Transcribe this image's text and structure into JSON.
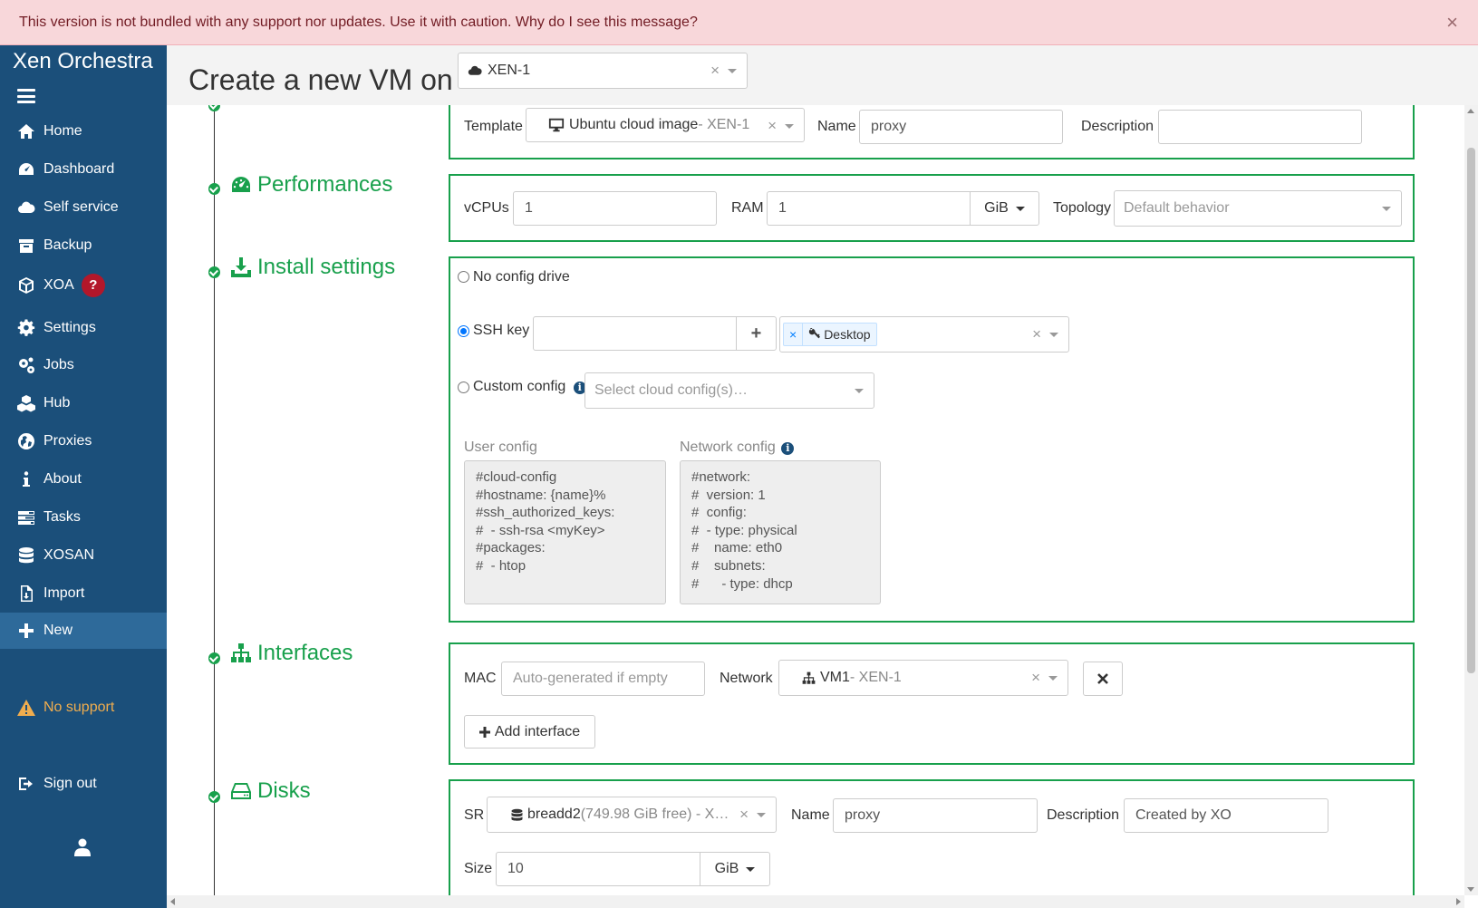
{
  "banner": {
    "message": "This version is not bundled with any support nor updates. Use it with caution. Why do I see this message?",
    "close": "×"
  },
  "sidebar": {
    "brand": "Xen Orchestra",
    "items": [
      {
        "label": "Home",
        "icon": "home-icon"
      },
      {
        "label": "Dashboard",
        "icon": "dashboard-icon"
      },
      {
        "label": "Self service",
        "icon": "cloud-icon"
      },
      {
        "label": "Backup",
        "icon": "archive-icon"
      },
      {
        "label": "XOA",
        "icon": "cube-icon",
        "badge": "?"
      },
      {
        "label": "Settings",
        "icon": "gear-icon"
      },
      {
        "label": "Jobs",
        "icon": "gears-icon"
      },
      {
        "label": "Hub",
        "icon": "cubes-icon"
      },
      {
        "label": "Proxies",
        "icon": "globe-icon"
      },
      {
        "label": "About",
        "icon": "info-icon"
      },
      {
        "label": "Tasks",
        "icon": "tasks-icon"
      },
      {
        "label": "XOSAN",
        "icon": "database-icon"
      },
      {
        "label": "Import",
        "icon": "file-import-icon"
      },
      {
        "label": "New",
        "icon": "plus-icon",
        "active": true
      }
    ],
    "no_support": "No support",
    "sign_out": "Sign out"
  },
  "header": {
    "title": "Create a new VM on",
    "pool": "XEN-1"
  },
  "infos": {
    "template_label": "Template",
    "template_value": "Ubuntu cloud image",
    "template_pool": " - XEN-1",
    "name_label": "Name",
    "name_value": "proxy",
    "description_label": "Description",
    "description_value": ""
  },
  "performances": {
    "title": "Performances",
    "vcpus_label": "vCPUs",
    "vcpus_value": "1",
    "ram_label": "RAM",
    "ram_value": "1",
    "ram_unit": "GiB",
    "topology_label": "Topology",
    "topology_placeholder": "Default behavior"
  },
  "install": {
    "title": "Install settings",
    "no_config": "No config drive",
    "ssh_key": "SSH key",
    "ssh_key_input": "",
    "ssh_add": "+",
    "ssh_tag": "Desktop",
    "custom_config": "Custom config",
    "cloud_config_placeholder": "Select cloud config(s)…",
    "user_config_label": "User config",
    "user_config": "#cloud-config\n#hostname: {name}%\n#ssh_authorized_keys:\n#  - ssh-rsa <myKey>\n#packages:\n#  - htop",
    "network_config_label": "Network config",
    "network_config": "#network:\n#  version: 1\n#  config:\n#  - type: physical\n#    name: eth0\n#    subnets:\n#      - type: dhcp"
  },
  "interfaces": {
    "title": "Interfaces",
    "mac_label": "MAC",
    "mac_placeholder": "Auto-generated if empty",
    "network_label": "Network",
    "network_value": "VM1",
    "network_pool": " - XEN-1",
    "add_interface": "Add interface"
  },
  "disks": {
    "title": "Disks",
    "sr_label": "SR",
    "sr_value": "breadd2",
    "sr_detail": " (749.98 GiB free) - X…",
    "name_label": "Name",
    "name_value": "proxy",
    "description_label": "Description",
    "description_value": "Created by XO",
    "size_label": "Size",
    "size_value": "10",
    "size_unit": "GiB"
  },
  "colors": {
    "sidebar": "#1b4f7a",
    "accent_green": "#18a04c",
    "banner_bg": "#f8d7da",
    "banner_text": "#721c24"
  }
}
